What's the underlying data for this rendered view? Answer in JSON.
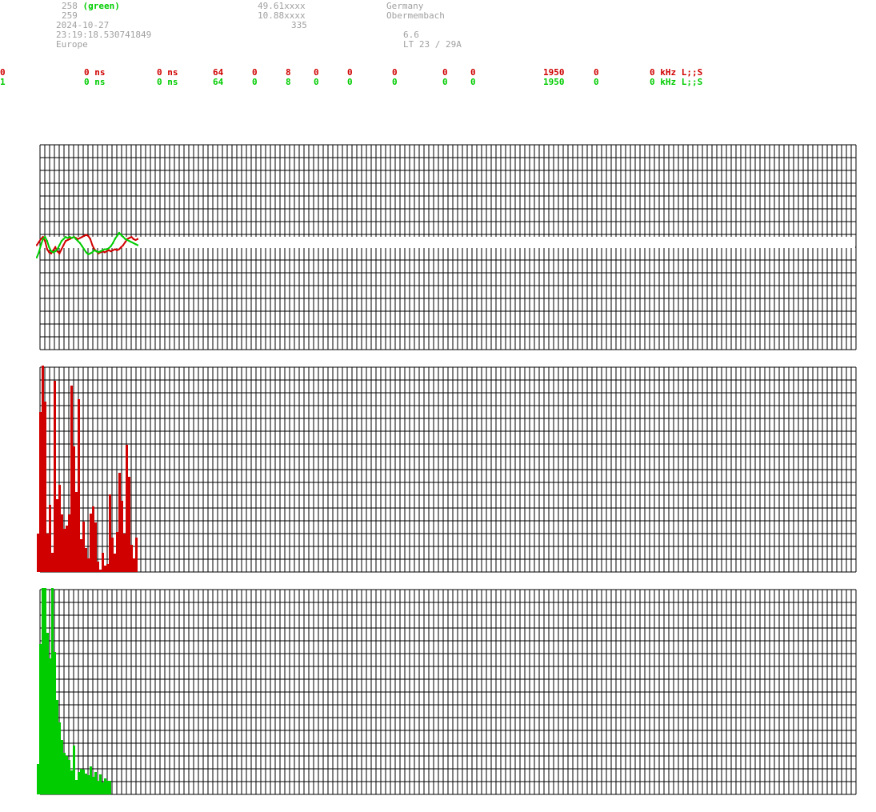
{
  "header": {
    "col1": [
      "258",
      "259",
      "2024-10-27",
      "23:19:18.530741849",
      "Europe"
    ],
    "col1_green_suffix": "(green)",
    "col2": [
      "49.61xxxx",
      "10.88xxxx",
      "335"
    ],
    "col3": [
      "Germany",
      "Obermembach"
    ],
    "col4": [
      "6.6",
      "LT 23 / 29A"
    ]
  },
  "rows": [
    {
      "cells": [
        "0",
        "0 ns",
        "0 ns",
        "64",
        "0",
        "8",
        "0",
        "0",
        "0",
        "0",
        "0",
        "1950",
        "0",
        "0 kHz L;;S"
      ]
    },
    {
      "cells": [
        "1",
        "0 ns",
        "0 ns",
        "64",
        "0",
        "8",
        "0",
        "0",
        "0",
        "0",
        "0",
        "1950",
        "0",
        "0 kHz L;;S"
      ]
    }
  ],
  "colors": {
    "red": "#d00000",
    "green": "#00cc00",
    "grid": "#000000",
    "header_text": "#a0a0a0"
  },
  "chart_data": [
    {
      "type": "line",
      "series": [
        {
          "color": "#d00000",
          "values": [
            0.02,
            0.05,
            0.08,
            0.1,
            0.06,
            -0.02,
            -0.05,
            -0.06,
            -0.03,
            0.0,
            -0.04,
            -0.06,
            -0.02,
            0.02,
            0.06,
            0.07,
            0.08,
            0.09,
            0.1,
            0.09,
            0.08,
            0.09,
            0.1,
            0.11,
            0.12,
            0.11,
            0.08,
            0.02,
            -0.02,
            -0.04,
            -0.06,
            -0.05,
            -0.04,
            -0.05,
            -0.04,
            -0.03,
            -0.04,
            -0.03,
            -0.02,
            -0.03,
            -0.02,
            0.0,
            0.02,
            0.05,
            0.08,
            0.09,
            0.1,
            0.08,
            0.07,
            0.08
          ]
        },
        {
          "color": "#00cc00",
          "values": [
            -0.1,
            -0.05,
            0.02,
            0.08,
            0.1,
            0.06,
            0.0,
            -0.04,
            -0.05,
            -0.04,
            -0.02,
            0.02,
            0.06,
            0.08,
            0.1,
            0.09,
            0.1,
            0.09,
            0.1,
            0.08,
            0.06,
            0.04,
            0.01,
            -0.02,
            -0.05,
            -0.07,
            -0.06,
            -0.05,
            -0.03,
            -0.04,
            -0.05,
            -0.04,
            -0.03,
            -0.02,
            -0.02,
            -0.01,
            0.01,
            0.04,
            0.08,
            0.11,
            0.14,
            0.12,
            0.1,
            0.08,
            0.07,
            0.06,
            0.05,
            0.04,
            0.03,
            0.02
          ]
        }
      ],
      "ylim": [
        -1,
        1
      ],
      "grid": true
    },
    {
      "type": "bar",
      "color": "#d00000",
      "values": [
        48,
        200,
        258,
        213,
        48,
        84,
        24,
        239,
        91,
        109,
        72,
        54,
        58,
        72,
        233,
        157,
        100,
        216,
        41,
        63,
        30,
        17,
        73,
        82,
        62,
        13,
        3,
        24,
        8,
        10,
        97,
        43,
        23,
        50,
        124,
        89,
        48,
        159,
        119,
        34,
        17,
        43
      ],
      "ylim": [
        0,
        256
      ],
      "grid": true
    },
    {
      "type": "bar",
      "color": "#00cc00",
      "values": [
        38,
        188,
        258,
        258,
        202,
        170,
        258,
        178,
        118,
        90,
        68,
        52,
        48,
        43,
        30,
        61,
        18,
        28,
        32,
        31,
        26,
        24,
        35,
        22,
        28,
        17,
        25,
        15,
        20,
        17,
        17
      ],
      "ylim": [
        0,
        256
      ],
      "grid": true
    }
  ]
}
